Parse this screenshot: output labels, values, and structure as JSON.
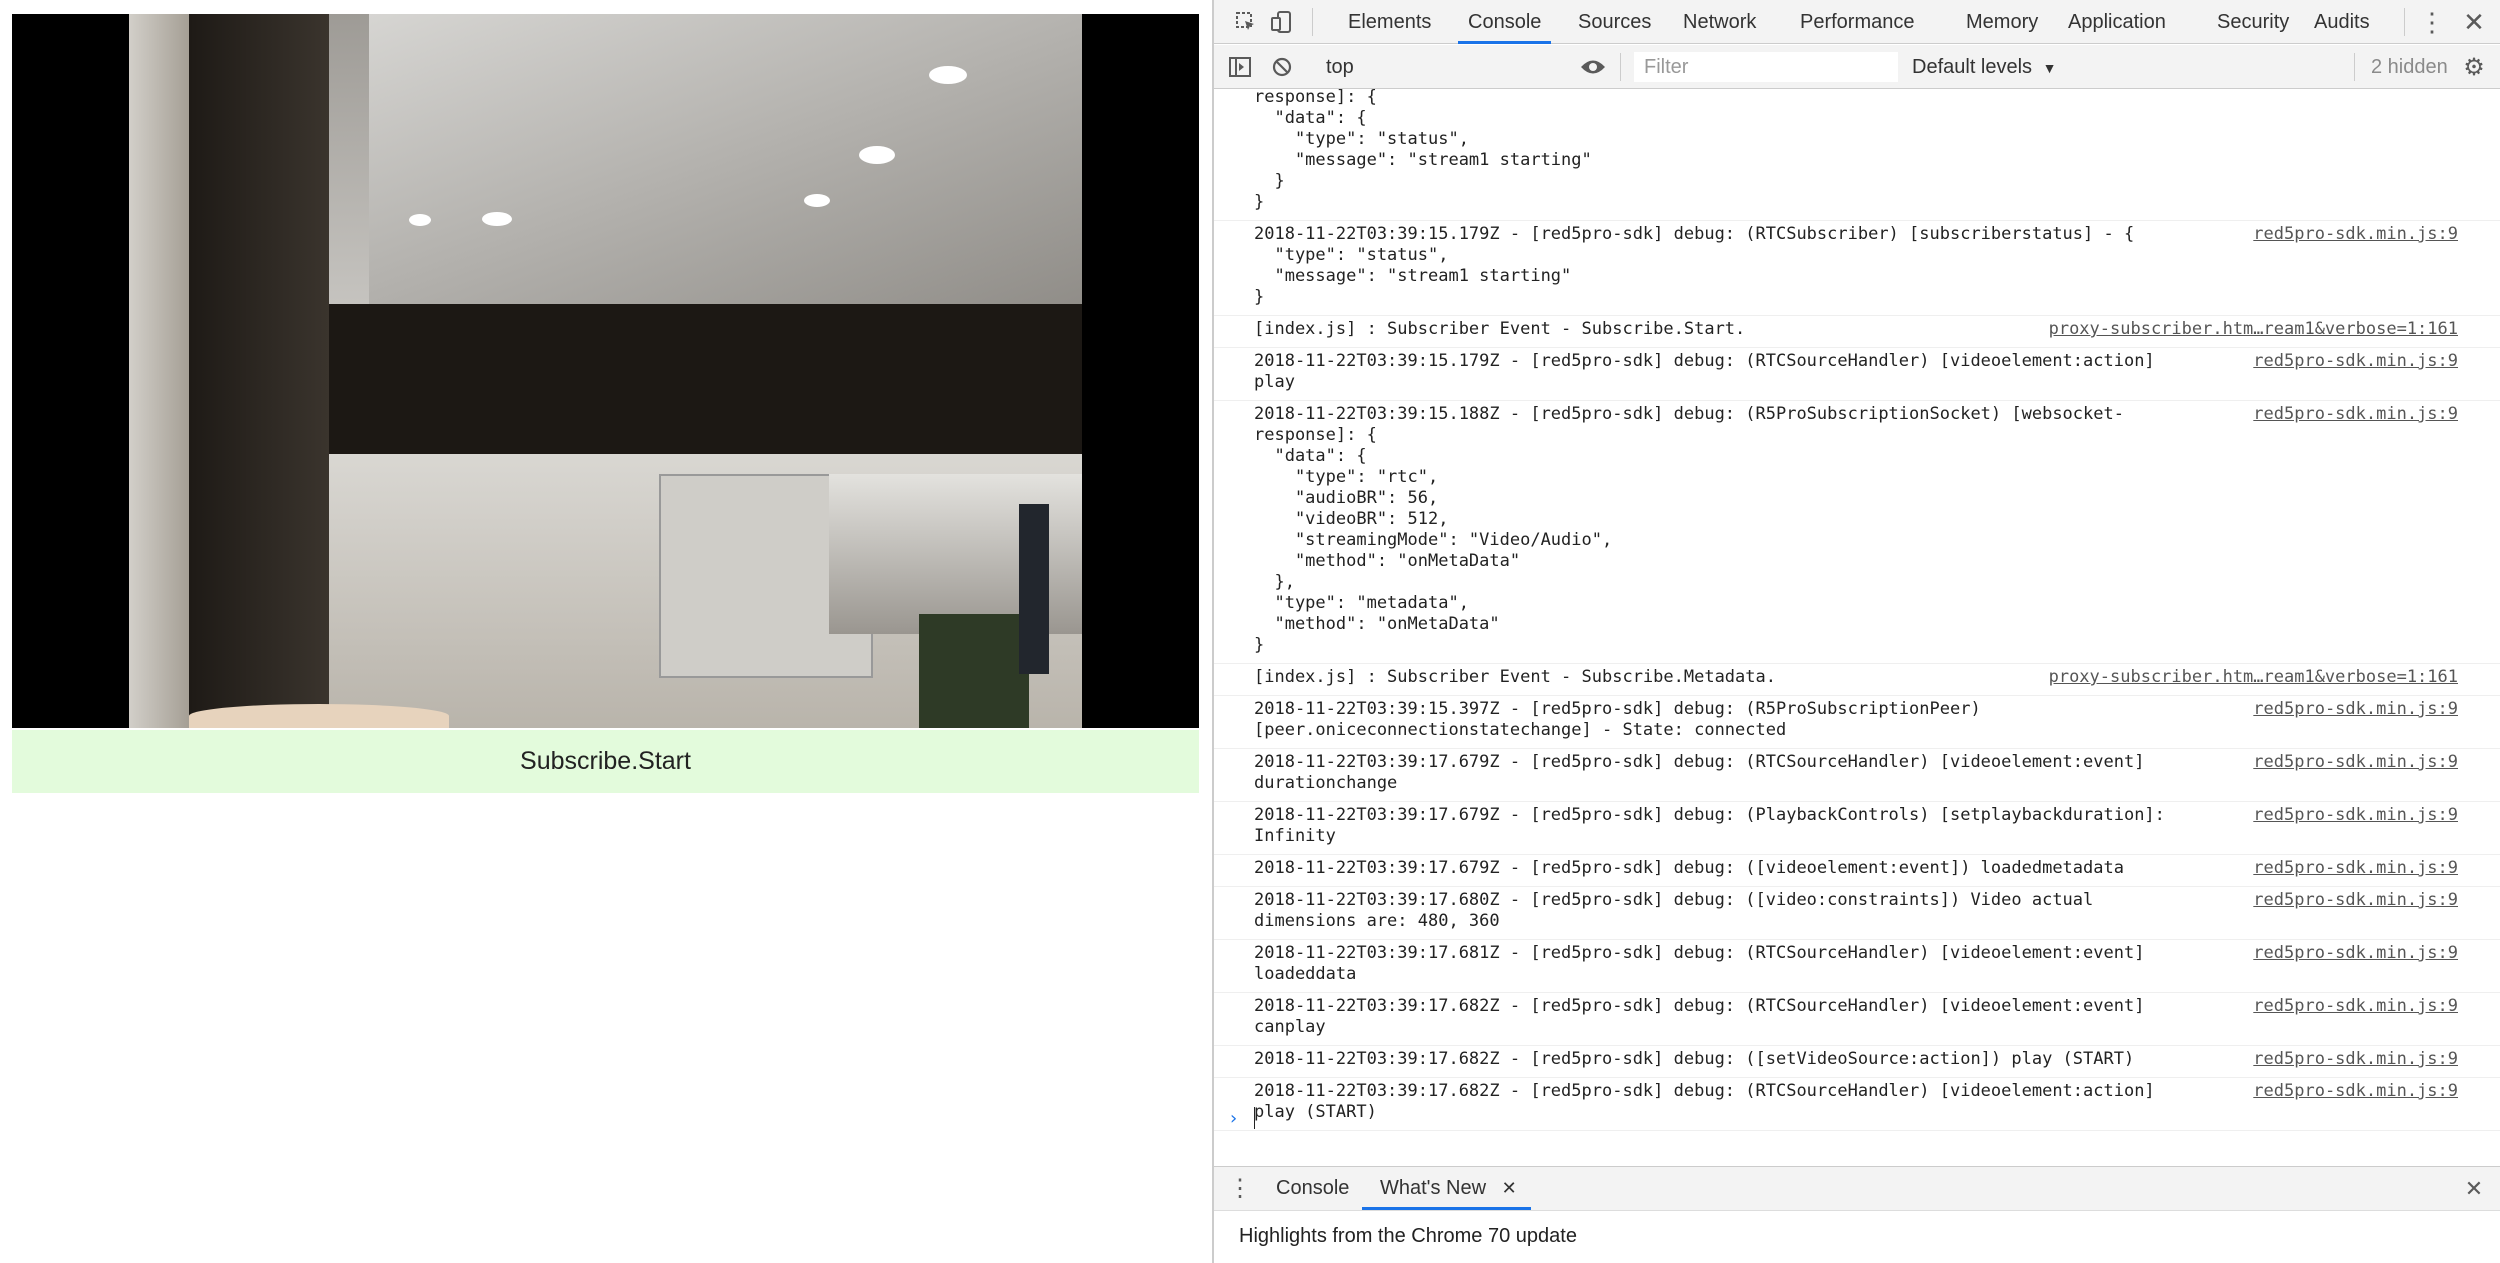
{
  "page": {
    "status_text": "Subscribe.Start"
  },
  "devtools": {
    "tabs": [
      "Elements",
      "Console",
      "Sources",
      "Network",
      "Performance",
      "Memory",
      "Application",
      "Security",
      "Audits"
    ],
    "active_tab": "Console",
    "toolbar": {
      "context": "top",
      "filter_placeholder": "Filter",
      "levels": "Default levels",
      "hidden": "2 hidden"
    },
    "messages": [
      {
        "text": "response]: {\n  \"data\": {\n    \"type\": \"status\",\n    \"message\": \"stream1 starting\"\n  }\n}",
        "src": ""
      },
      {
        "text": "2018-11-22T03:39:15.179Z - [red5pro-sdk] debug: (RTCSubscriber) [subscriberstatus] - {\n  \"type\": \"status\",\n  \"message\": \"stream1 starting\"\n}",
        "src": "red5pro-sdk.min.js:9"
      },
      {
        "text": "[index.js] : Subscriber Event - Subscribe.Start.",
        "src": "proxy-subscriber.htm…ream1&verbose=1:161"
      },
      {
        "text": "2018-11-22T03:39:15.179Z - [red5pro-sdk] debug: (RTCSourceHandler) [videoelement:action]\nplay",
        "src": "red5pro-sdk.min.js:9"
      },
      {
        "text": "2018-11-22T03:39:15.188Z - [red5pro-sdk] debug: (R5ProSubscriptionSocket) [websocket-\nresponse]: {\n  \"data\": {\n    \"type\": \"rtc\",\n    \"audioBR\": 56,\n    \"videoBR\": 512,\n    \"streamingMode\": \"Video/Audio\",\n    \"method\": \"onMetaData\"\n  },\n  \"type\": \"metadata\",\n  \"method\": \"onMetaData\"\n}",
        "src": "red5pro-sdk.min.js:9"
      },
      {
        "text": "[index.js] : Subscriber Event - Subscribe.Metadata.",
        "src": "proxy-subscriber.htm…ream1&verbose=1:161"
      },
      {
        "text": "2018-11-22T03:39:15.397Z - [red5pro-sdk] debug: (R5ProSubscriptionPeer)\n[peer.oniceconnectionstatechange] - State: connected",
        "src": "red5pro-sdk.min.js:9"
      },
      {
        "text": "2018-11-22T03:39:17.679Z - [red5pro-sdk] debug: (RTCSourceHandler) [videoelement:event]\ndurationchange",
        "src": "red5pro-sdk.min.js:9"
      },
      {
        "text": "2018-11-22T03:39:17.679Z - [red5pro-sdk] debug: (PlaybackControls) [setplaybackduration]:\nInfinity",
        "src": "red5pro-sdk.min.js:9"
      },
      {
        "text": "2018-11-22T03:39:17.679Z - [red5pro-sdk] debug: ([videoelement:event]) loadedmetadata",
        "src": "red5pro-sdk.min.js:9"
      },
      {
        "text": "2018-11-22T03:39:17.680Z - [red5pro-sdk] debug: ([video:constraints]) Video actual\ndimensions are: 480, 360",
        "src": "red5pro-sdk.min.js:9"
      },
      {
        "text": "2018-11-22T03:39:17.681Z - [red5pro-sdk] debug: (RTCSourceHandler) [videoelement:event]\nloadeddata",
        "src": "red5pro-sdk.min.js:9"
      },
      {
        "text": "2018-11-22T03:39:17.682Z - [red5pro-sdk] debug: (RTCSourceHandler) [videoelement:event]\ncanplay",
        "src": "red5pro-sdk.min.js:9"
      },
      {
        "text": "2018-11-22T03:39:17.682Z - [red5pro-sdk] debug: ([setVideoSource:action]) play (START)",
        "src": "red5pro-sdk.min.js:9"
      },
      {
        "text": "2018-11-22T03:39:17.682Z - [red5pro-sdk] debug: (RTCSourceHandler) [videoelement:action]\nplay (START)",
        "src": "red5pro-sdk.min.js:9"
      }
    ],
    "drawer": {
      "tabs": [
        "Console",
        "What's New"
      ],
      "active_tab": "What's New",
      "body": "Highlights from the Chrome 70 update"
    },
    "accent_color": "#1a73e8"
  }
}
